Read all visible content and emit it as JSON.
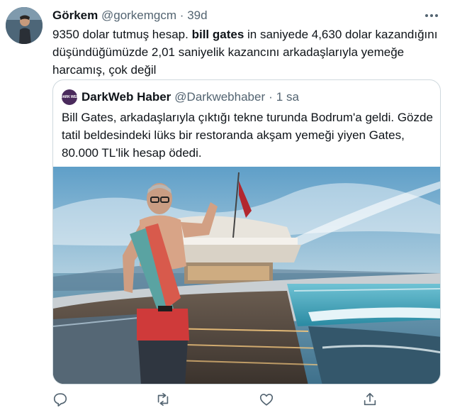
{
  "tweet": {
    "author_name": "Görkem",
    "author_handle": "@gorkemgcm",
    "separator": "·",
    "time": "39d",
    "text_part1": "9350 dolar tutmuş hesap.",
    "text_bold": "bill gates",
    "text_part2": "in saniyede 4,630 dolar kazandığını düşündüğümüzde 2,01 saniyelik kazancını arkadaşlarıyla yemeğe harcamış, çok değil"
  },
  "quote": {
    "avatar_text": "DARK WEB",
    "author_name": "DarkWeb Haber",
    "author_handle": "@Darkwebhaber",
    "separator": "·",
    "time": "1 sa",
    "text": "Bill Gates, arkadaşlarıyla çıktığı tekne turunda Bodrum'a geldi. Gözde tatil beldesindeki lüks bir restoranda akşam yemeği yiyen Gates, 80.000 TL'lik hesap ödedi."
  },
  "actions": [
    "reply-icon",
    "retweet-icon",
    "like-icon",
    "share-icon"
  ],
  "colors": {
    "text": "#0f1419",
    "secondary": "#536471",
    "border": "#cfd9de"
  }
}
